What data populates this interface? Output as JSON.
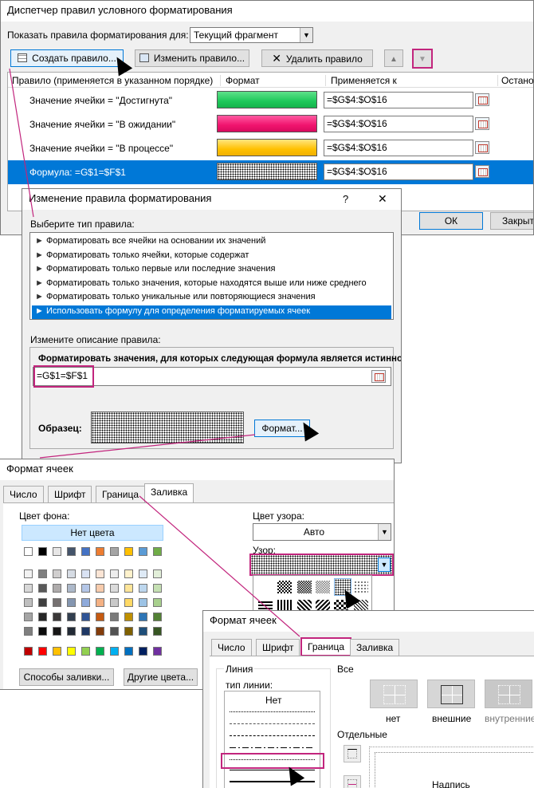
{
  "manager": {
    "title": "Диспетчер правил условного форматирования",
    "show_label": "Показать правила форматирования для:",
    "show_value": "Текущий фрагмент",
    "create_btn": "Создать правило...",
    "edit_btn": "Изменить правило...",
    "delete_btn": "Удалить правило",
    "col_rule": "Правило (применяется в указанном порядке)",
    "col_format": "Формат",
    "col_applies": "Применяется к",
    "col_stop": "Остано",
    "ok": "ОК",
    "close": "Закрыт",
    "rules": [
      {
        "name": "Значение ячейки = \"Достигнута\"",
        "range": "=$G$4:$O$16",
        "color": "#1ec85a"
      },
      {
        "name": "Значение ячейки = \"В ожидании\"",
        "range": "=$G$4:$O$16",
        "color": "#f0146e"
      },
      {
        "name": "Значение ячейки = \"В процессе\"",
        "range": "=$G$4:$O$16",
        "color": "#ffc000"
      },
      {
        "name": "Формула: =G$1=$F$1",
        "range": "=$G$4:$O$16",
        "color": "dotted"
      }
    ]
  },
  "edit": {
    "title": "Изменение правила форматирования",
    "help": "?",
    "close": "✕",
    "select_type_label": "Выберите тип правила:",
    "types": [
      "Форматировать все ячейки на основании их значений",
      "Форматировать только ячейки, которые содержат",
      "Форматировать только первые или последние значения",
      "Форматировать только значения, которые находятся выше или ниже среднего",
      "Форматировать только уникальные или повторяющиеся значения",
      "Использовать формулу для определения форматируемых ячеек"
    ],
    "desc_label": "Измените описание правила:",
    "formula_label": "Форматировать значения, для которых следующая формула является истинной:",
    "formula": "=G$1=$F$1",
    "sample_label": "Образец:",
    "format_btn": "Формат..."
  },
  "cells1": {
    "title": "Формат ячеек",
    "tabs": [
      "Число",
      "Шрифт",
      "Граница",
      "Заливка"
    ],
    "bg_label": "Цвет фона:",
    "no_color": "Нет цвета",
    "pattern_color_label": "Цвет узора:",
    "pattern_color": "Авто",
    "pattern_label": "Узор:",
    "fill_effects": "Способы заливки...",
    "more_colors": "Другие цвета...",
    "row1": [
      "#ffffff",
      "#000000",
      "#e7e6e6",
      "#44546a",
      "#4472c4",
      "#ed7d31",
      "#a5a5a5",
      "#ffc000",
      "#5b9bd5",
      "#70ad47"
    ],
    "theme": [
      [
        "#f2f2f2",
        "#7f7f7f",
        "#d0cece",
        "#d6dce4",
        "#d9e2f3",
        "#fbe5d5",
        "#ededed",
        "#fff2cc",
        "#deeaf6",
        "#e2efd9"
      ],
      [
        "#d8d8d8",
        "#595959",
        "#aeabab",
        "#adb9ca",
        "#b4c6e7",
        "#f7cbac",
        "#dbdbdb",
        "#fee599",
        "#bdd7ee",
        "#c5e0b3"
      ],
      [
        "#bfbfbf",
        "#3f3f3f",
        "#757070",
        "#8496b0",
        "#8eaadb",
        "#f4b183",
        "#c9c9c9",
        "#ffd965",
        "#9cc3e5",
        "#a8d08d"
      ],
      [
        "#a5a5a5",
        "#262626",
        "#3a3838",
        "#323f4f",
        "#2f5496",
        "#c55a11",
        "#7b7b7b",
        "#bf9000",
        "#2e75b5",
        "#538135"
      ],
      [
        "#7f7f7f",
        "#0c0c0c",
        "#171616",
        "#222a35",
        "#1f3864",
        "#833c0b",
        "#525252",
        "#7f6000",
        "#1e4e79",
        "#375623"
      ]
    ],
    "standard": [
      "#c00000",
      "#ff0000",
      "#ffc000",
      "#ffff00",
      "#92d050",
      "#00b050",
      "#00b0f0",
      "#0070c0",
      "#002060",
      "#7030a0"
    ]
  },
  "cells2": {
    "title": "Формат ячеек",
    "tabs": [
      "Число",
      "Шрифт",
      "Граница",
      "Заливка"
    ],
    "line_group": "Линия",
    "line_type_label": "тип линии:",
    "none": "Нет",
    "all_label": "Все",
    "presets": [
      "нет",
      "внешние",
      "внутренние"
    ],
    "separate_label": "Отдельные",
    "caption": "Надпись"
  }
}
